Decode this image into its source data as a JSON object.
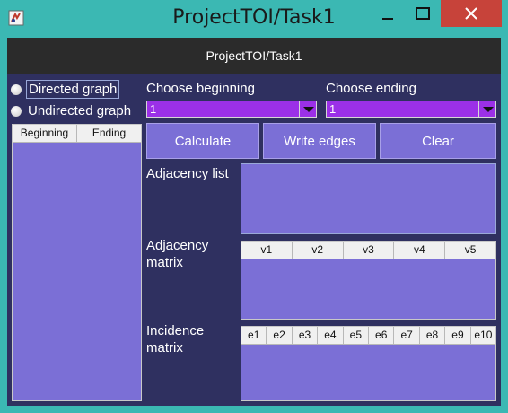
{
  "window": {
    "title": "ProjectTOI/Task1"
  },
  "header": {
    "title": "ProjectTOI/Task1"
  },
  "graph_type": {
    "directed_label": "Directed graph",
    "undirected_label": "Undirected graph"
  },
  "edges_table": {
    "columns": [
      "Beginning",
      "Ending"
    ]
  },
  "choose_beginning": {
    "label": "Choose beginning",
    "value": "1"
  },
  "choose_ending": {
    "label": "Choose ending",
    "value": "1"
  },
  "buttons": {
    "calculate": "Calculate",
    "write_edges": "Write edges",
    "clear": "Clear"
  },
  "adjacency_list": {
    "label": "Adjacency list"
  },
  "adjacency_matrix": {
    "label_line1": "Adjacency",
    "label_line2": "matrix",
    "columns": [
      "v1",
      "v2",
      "v3",
      "v4",
      "v5"
    ]
  },
  "incidence_matrix": {
    "label_line1": "Incidence",
    "label_line2": "matrix",
    "columns": [
      "e1",
      "e2",
      "e3",
      "e4",
      "e5",
      "e6",
      "e7",
      "e8",
      "e9",
      "e10"
    ]
  },
  "colors": {
    "titlebar": "#3bb8b3",
    "background": "#2f3060",
    "accent": "#7b6fd6",
    "combo": "#9b30e8",
    "close": "#c7433a"
  }
}
